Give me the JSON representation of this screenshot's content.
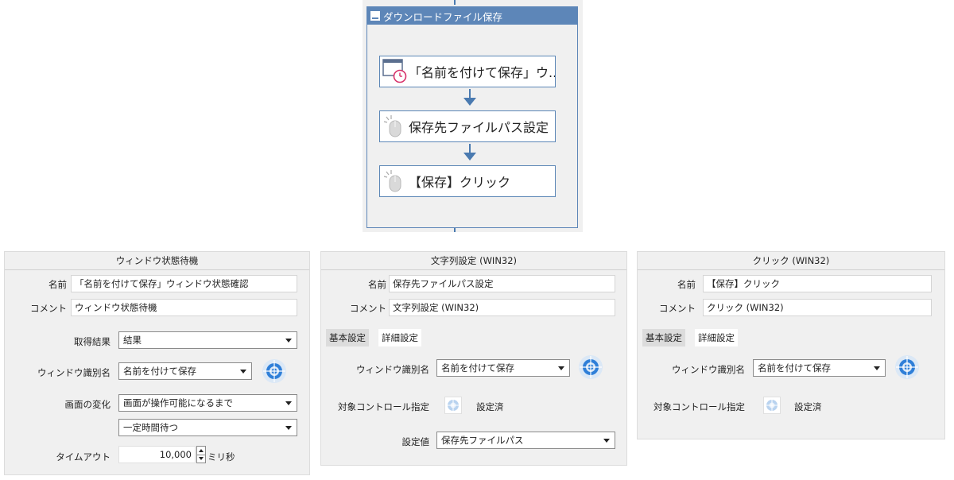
{
  "flow": {
    "title": "ダウンロードファイル保存",
    "nodes": [
      {
        "label": "「名前を付けて保存」ウ...",
        "icon": "window-clock-icon"
      },
      {
        "label": "保存先ファイルパス設定",
        "icon": "mouse-icon"
      },
      {
        "label": "【保存】クリック",
        "icon": "mouse-icon"
      }
    ]
  },
  "panel_wait": {
    "title": "ウィンドウ状態待機",
    "name_label": "名前",
    "name_value": "「名前を付けて保存」ウィンドウ状態確認",
    "comment_label": "コメント",
    "comment_value": "ウィンドウ状態待機",
    "result_label": "取得結果",
    "result_value": "結果",
    "window_label": "ウィンドウ識別名",
    "window_value": "名前を付けて保存",
    "change_label": "画面の変化",
    "change_value": "画面が操作可能になるまで",
    "wait_value": "一定時間待つ",
    "timeout_label": "タイムアウト",
    "timeout_value": "10,000",
    "timeout_unit": "ミリ秒"
  },
  "panel_text": {
    "title": "文字列設定 (WIN32)",
    "name_label": "名前",
    "name_value": "保存先ファイルパス設定",
    "comment_label": "コメント",
    "comment_value": "文字列設定 (WIN32)",
    "tab_basic": "基本設定",
    "tab_detail": "詳細設定",
    "window_label": "ウィンドウ識別名",
    "window_value": "名前を付けて保存",
    "target_label": "対象コントロール指定",
    "target_status": "設定済",
    "value_label": "設定値",
    "value_value": "保存先ファイルパス"
  },
  "panel_click": {
    "title": "クリック (WIN32)",
    "name_label": "名前",
    "name_value": "【保存】クリック",
    "comment_label": "コメント",
    "comment_value": "クリック (WIN32)",
    "tab_basic": "基本設定",
    "tab_detail": "詳細設定",
    "window_label": "ウィンドウ識別名",
    "window_value": "名前を付けて保存",
    "target_label": "対象コントロール指定",
    "target_status": "設定済"
  },
  "colors": {
    "accent": "#5d86b8",
    "arrow": "#4a7ab0",
    "panel_bg": "#f0f0f0",
    "target_blue": "#2f7fd8"
  }
}
